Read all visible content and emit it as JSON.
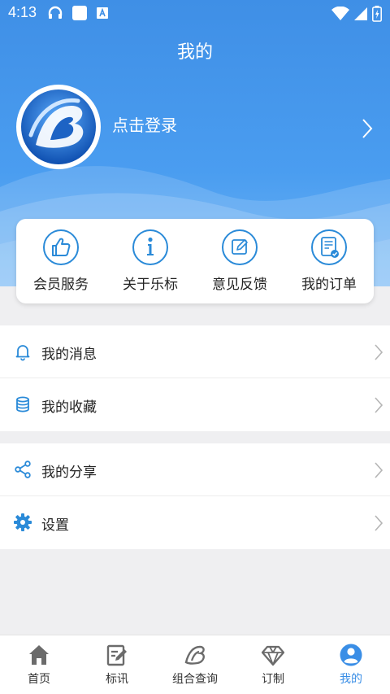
{
  "status_bar": {
    "time": "4:13",
    "icon_names": [
      "headset-icon",
      "square-icon",
      "keyboard-a-icon",
      "wifi-icon",
      "signal-icon",
      "battery-icon"
    ]
  },
  "header": {
    "title": "我的",
    "login_text": "点击登录"
  },
  "quick_actions": [
    {
      "label": "会员服务",
      "icon": "thumbs-up-icon"
    },
    {
      "label": "关于乐标",
      "icon": "info-icon"
    },
    {
      "label": "意见反馈",
      "icon": "edit-icon"
    },
    {
      "label": "我的订单",
      "icon": "order-icon"
    }
  ],
  "list_group_1": [
    {
      "label": "我的消息",
      "icon": "bell-icon"
    },
    {
      "label": "我的收藏",
      "icon": "database-icon"
    }
  ],
  "list_group_2": [
    {
      "label": "我的分享",
      "icon": "share-icon"
    },
    {
      "label": "设置",
      "icon": "gear-icon"
    }
  ],
  "bottom_nav": [
    {
      "label": "首页",
      "icon": "home-icon"
    },
    {
      "label": "标讯",
      "icon": "news-edit-icon"
    },
    {
      "label": "组合查询",
      "icon": "logo-b-icon"
    },
    {
      "label": "订制",
      "icon": "diamond-icon"
    },
    {
      "label": "我的",
      "icon": "user-icon",
      "active": true
    }
  ],
  "colors": {
    "primary": "#3a8ee6",
    "header_top": "#3f8fe6",
    "icon_blue": "#2a8ad8",
    "background": "#efeff1"
  }
}
